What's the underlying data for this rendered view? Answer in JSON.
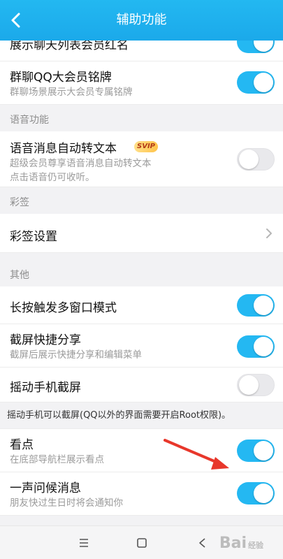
{
  "header": {
    "title": "辅助功能"
  },
  "rows": {
    "partial_top": {
      "title": "展示聊天列表会员红名",
      "toggle": "on"
    },
    "group_vip": {
      "title": "群聊QQ大会员铭牌",
      "sub": "群聊场景展示大会员专属铭牌",
      "toggle": "on"
    },
    "voice_to_text": {
      "title": "语音消息自动转文本",
      "badge": "SVIP",
      "sub1": "超级会员尊享语音消息自动转文本",
      "sub2": "点击语音仍可收听。",
      "toggle": "off"
    },
    "caiqian_setting": {
      "title": "彩签设置"
    },
    "long_press_multi": {
      "title": "长按触发多窗口模式",
      "toggle": "on"
    },
    "screenshot_share": {
      "title": "截屏快捷分享",
      "sub": "截屏后展示快捷分享和编辑菜单",
      "toggle": "on"
    },
    "shake_screenshot": {
      "title": "摇动手机截屏",
      "toggle": "off"
    },
    "kandian": {
      "title": "看点",
      "sub": "在底部导航栏展示看点",
      "toggle": "on"
    },
    "greeting": {
      "title": "一声问候消息",
      "sub": "朋友快过生日时将会通知你",
      "toggle": "on"
    }
  },
  "sections": {
    "voice": "语音功能",
    "caiqian": "彩签",
    "other": "其他"
  },
  "notes": {
    "shake": "摇动手机可以截屏(QQ以外的界面需要开启Root权限)。"
  },
  "watermark": {
    "text": "Bai",
    "suffix": "经验"
  },
  "colors": {
    "accent": "#24b8f2",
    "header": "#1ba9ea",
    "annotation_arrow": "#e8372b"
  }
}
